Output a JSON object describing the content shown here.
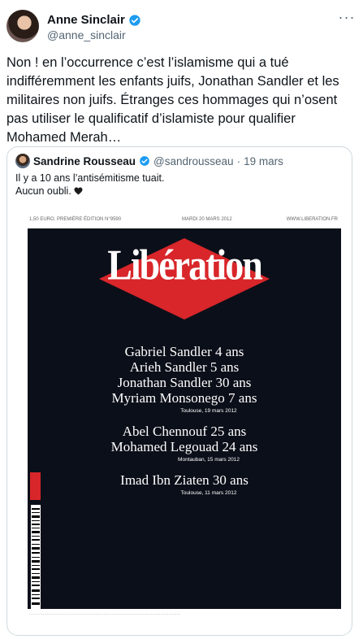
{
  "tweet": {
    "author_name": "Anne Sinclair",
    "author_handle": "@anne_sinclair",
    "more_icon": "ellipsis-icon",
    "text": "Non ! en l’occurrence c’est l’islamisme qui a tué indifféremment les enfants juifs, Jonathan Sandler et les militaires non juifs. Étranges ces hommages qui n’osent pas utiliser le qualificatif d’islamiste pour qualifier Mohamed Merah…"
  },
  "quote": {
    "author_name": "Sandrine Rousseau",
    "author_handle": "@sandrousseau",
    "separator": "·",
    "date": "19 mars",
    "line1": "Il y a 10 ans l’antisémitisme tuait.",
    "line2": "Aucun oubli."
  },
  "cover": {
    "top_left": "1,50 EURO. PREMIÈRE ÉDITION N°9590",
    "top_mid": "MARDI 20 MARS 2012",
    "top_right": "WWW.LIBERATION.FR",
    "masthead": "Libération",
    "group1": [
      "Gabriel Sandler 4 ans",
      "Arieh Sandler 5 ans",
      "Jonathan Sandler 30 ans",
      "Myriam Monsonego 7 ans"
    ],
    "place1": "Toulouse, 19 mars 2012",
    "group2": [
      "Abel Chennouf 25 ans",
      "Mohamed Legouad 24 ans"
    ],
    "place2": "Montauban, 15 mars 2012",
    "group3": [
      "Imad Ibn Ziaten 30 ans"
    ],
    "place3": "Toulouse, 11 mars 2012"
  },
  "colors": {
    "accent": "#1d9bf0",
    "cover_bg": "#0b0f19",
    "red": "#d8262a"
  }
}
